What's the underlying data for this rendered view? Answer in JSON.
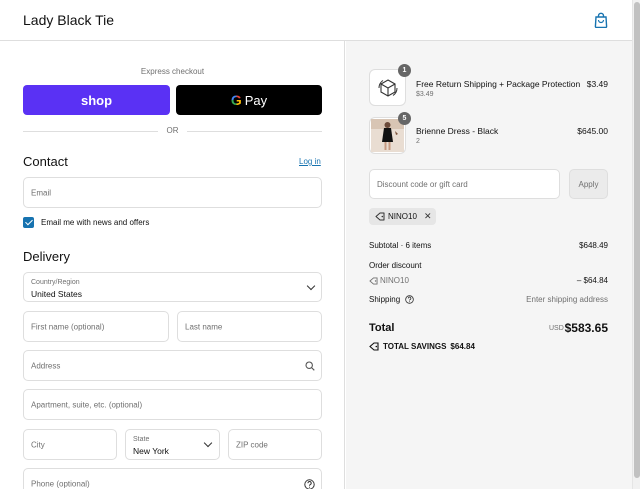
{
  "header": {
    "brand": "Lady Black Tie",
    "cart_icon": "shopping-bag-icon"
  },
  "left": {
    "express_title": "Express checkout",
    "shop_label": "shop",
    "gpay_g": "G",
    "gpay_label": "Pay",
    "or_text": "OR",
    "contact": {
      "title": "Contact",
      "login": "Log in",
      "email_placeholder": "Email",
      "newsletter_label": "Email me with news and offers"
    },
    "delivery": {
      "title": "Delivery",
      "country_label": "Country/Region",
      "country_value": "United States",
      "first_name_placeholder": "First name (optional)",
      "last_name_placeholder": "Last name",
      "address_placeholder": "Address",
      "apartment_placeholder": "Apartment, suite, etc. (optional)",
      "city_placeholder": "City",
      "state_label": "State",
      "state_value": "New York",
      "zip_placeholder": "ZIP code",
      "phone_placeholder": "Phone (optional)"
    }
  },
  "summary": {
    "items": [
      {
        "name": "Free Return Shipping + Package Protection",
        "sub": "$3.49",
        "price": "$3.49",
        "qty": "1"
      },
      {
        "name": "Brienne Dress - Black",
        "sub": "2",
        "price": "$645.00",
        "qty": "5"
      }
    ],
    "discount_placeholder": "Discount code or gift card",
    "apply_label": "Apply",
    "applied_code": "NINO10",
    "subtotal_label": "Subtotal · 6 items",
    "subtotal_value": "$648.49",
    "order_discount_label": "Order discount",
    "discount_code": "NINO10",
    "discount_value": "– $64.84",
    "shipping_label": "Shipping",
    "shipping_value": "Enter shipping address",
    "total_label": "Total",
    "total_currency": "USD",
    "total_value": "$583.65",
    "savings_label": "TOTAL SAVINGS",
    "savings_value": "$64.84"
  }
}
